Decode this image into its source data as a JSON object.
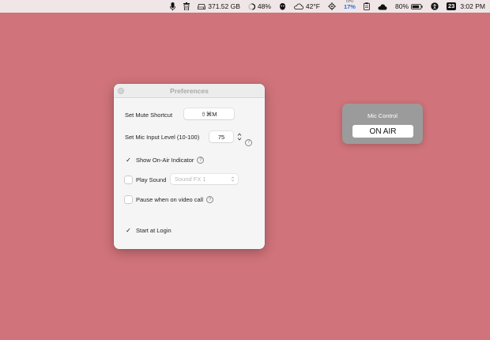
{
  "menubar": {
    "disk": "371.52 GB",
    "battery_ring": "48%",
    "weather": "42°F",
    "cpu_label": "CPU",
    "cpu_value": "17%",
    "battery": "80%",
    "date_badge": "23",
    "time": "3:02 PM"
  },
  "prefs": {
    "title": "Preferences",
    "mute_shortcut_label": "Set Mute Shortcut",
    "mute_shortcut_value": "⇧⌘M",
    "mic_level_label": "Set Mic Input Level (10-100)",
    "mic_level_value": "75",
    "show_onair_label": "Show On-Air Indicator",
    "show_onair_checked": true,
    "play_sound_label": "Play Sound",
    "play_sound_checked": false,
    "sound_select_value": "Sound FX 1",
    "pause_label": "Pause when on video call",
    "pause_checked": false,
    "login_label": "Start at Login",
    "login_checked": true,
    "help_glyph": "?",
    "check_glyph": "✓"
  },
  "mic_control": {
    "title": "Mic Control",
    "button_label": "ON AIR"
  },
  "colors": {
    "desktop": "#d0737a",
    "cpu_accent": "#2a6fd6"
  }
}
